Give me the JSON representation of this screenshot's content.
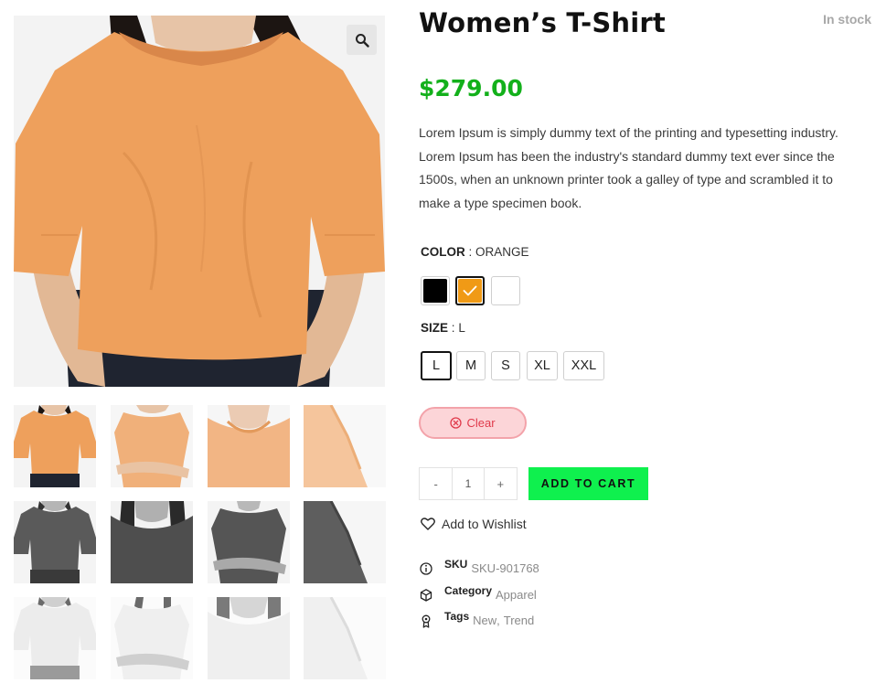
{
  "product": {
    "title": "Women’s T-Shirt",
    "stock_status": "In stock",
    "price": "$279.00",
    "description": "Lorem Ipsum is simply dummy text of the printing and typesetting industry. Lorem Ipsum has been the industry's standard dummy text ever since the 1500s, when an unknown printer took a galley of type and scrambled it to make a type specimen book."
  },
  "gallery": {
    "zoom_icon": "search-icon",
    "thumbnails": [
      {
        "color": "orange",
        "view": "front"
      },
      {
        "color": "orange",
        "view": "arms-crossed"
      },
      {
        "color": "orange",
        "view": "collar"
      },
      {
        "color": "orange",
        "view": "sleeve"
      },
      {
        "color": "black",
        "view": "front"
      },
      {
        "color": "black",
        "view": "collar"
      },
      {
        "color": "black",
        "view": "arms-crossed"
      },
      {
        "color": "black",
        "view": "sleeve"
      },
      {
        "color": "white",
        "view": "front"
      },
      {
        "color": "white",
        "view": "arms-crossed"
      },
      {
        "color": "white",
        "view": "collar"
      },
      {
        "color": "white",
        "view": "sleeve"
      }
    ]
  },
  "color": {
    "label": "COLOR",
    "separator": ":",
    "selected_value": "ORANGE",
    "swatches": [
      {
        "name": "black",
        "hex": "#000000",
        "selected": false
      },
      {
        "name": "orange",
        "hex": "#f09a16",
        "selected": true
      },
      {
        "name": "white",
        "hex": "#ffffff",
        "selected": false
      }
    ]
  },
  "size": {
    "label": "SIZE",
    "separator": ":",
    "selected_value": "L",
    "options": [
      "L",
      "M",
      "S",
      "XL",
      "XXL"
    ]
  },
  "clear_label": "Clear",
  "quantity": {
    "minus": "-",
    "value": "1",
    "plus": "+"
  },
  "add_to_cart_label": "ADD TO CART",
  "wishlist_label": "Add to Wishlist",
  "meta": {
    "sku": {
      "label": "SKU",
      "value": "SKU-901768"
    },
    "category": {
      "label": "Category",
      "value": "Apparel"
    },
    "tags": {
      "label": "Tags",
      "values": [
        "New",
        "Trend"
      ],
      "separator": ","
    }
  },
  "colors": {
    "price_green": "#13b01b",
    "cart_green": "#0ff04e",
    "clear_red": "#e03a4b",
    "shirt_orange": "#eea05c",
    "shirt_black": "#555555",
    "shirt_white": "#f4f4f4"
  }
}
